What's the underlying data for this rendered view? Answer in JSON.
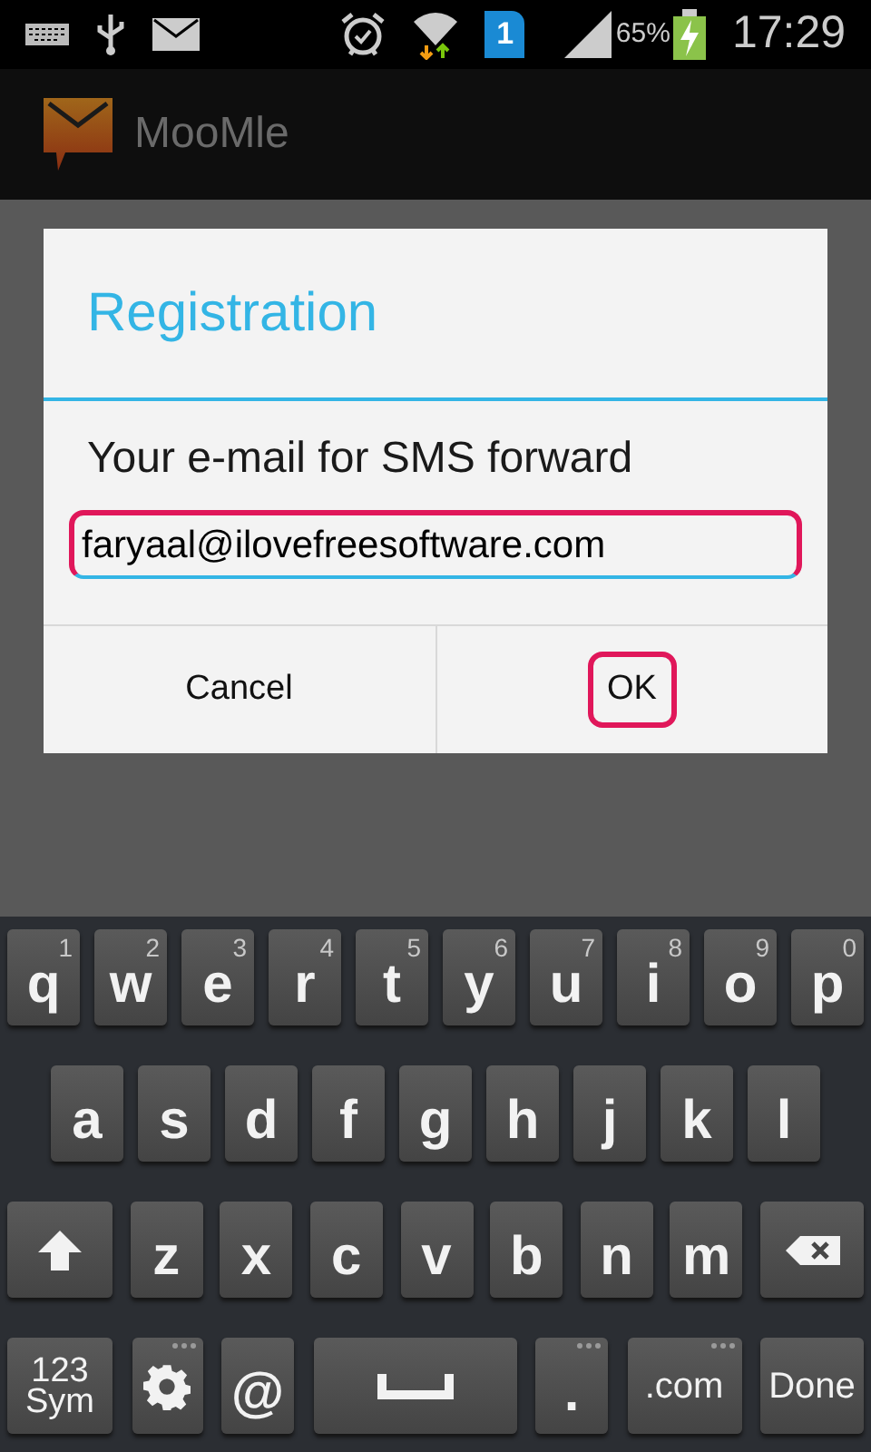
{
  "status_bar": {
    "sim_badge": "1",
    "battery": "65%",
    "time": "17:29"
  },
  "app_bar": {
    "title": "MooMle"
  },
  "dialog": {
    "title": "Registration",
    "label": "Your e-mail for SMS forward",
    "email_field": {
      "value": "faryaal@ilovefreesoftware.com",
      "highlighted": true
    },
    "buttons": [
      {
        "label": "Cancel",
        "highlighted": false
      },
      {
        "label": "OK",
        "highlighted": true
      }
    ]
  },
  "keyboard": {
    "rows": [
      {
        "keys": [
          {
            "kind": "char",
            "label": "q",
            "hint": "1"
          },
          {
            "kind": "char",
            "label": "w",
            "hint": "2"
          },
          {
            "kind": "char",
            "label": "e",
            "hint": "3"
          },
          {
            "kind": "char",
            "label": "r",
            "hint": "4"
          },
          {
            "kind": "char",
            "label": "t",
            "hint": "5"
          },
          {
            "kind": "char",
            "label": "y",
            "hint": "6"
          },
          {
            "kind": "char",
            "label": "u",
            "hint": "7"
          },
          {
            "kind": "char",
            "label": "i",
            "hint": "8"
          },
          {
            "kind": "char",
            "label": "o",
            "hint": "9"
          },
          {
            "kind": "char",
            "label": "p",
            "hint": "0"
          }
        ]
      },
      {
        "keys": [
          {
            "kind": "char",
            "label": "a"
          },
          {
            "kind": "char",
            "label": "s"
          },
          {
            "kind": "char",
            "label": "d"
          },
          {
            "kind": "char",
            "label": "f"
          },
          {
            "kind": "char",
            "label": "g"
          },
          {
            "kind": "char",
            "label": "h"
          },
          {
            "kind": "char",
            "label": "j"
          },
          {
            "kind": "char",
            "label": "k"
          },
          {
            "kind": "char",
            "label": "l"
          }
        ]
      },
      {
        "keys": [
          {
            "kind": "shift"
          },
          {
            "kind": "char",
            "label": "z"
          },
          {
            "kind": "char",
            "label": "x"
          },
          {
            "kind": "char",
            "label": "c"
          },
          {
            "kind": "char",
            "label": "v"
          },
          {
            "kind": "char",
            "label": "b"
          },
          {
            "kind": "char",
            "label": "n"
          },
          {
            "kind": "char",
            "label": "m"
          },
          {
            "kind": "backspace"
          }
        ]
      },
      {
        "keys": [
          {
            "kind": "sym",
            "label": "123",
            "label2": "Sym"
          },
          {
            "kind": "settings",
            "more": true
          },
          {
            "kind": "char",
            "label": "@"
          },
          {
            "kind": "space"
          },
          {
            "kind": "char",
            "label": ".",
            "more": true
          },
          {
            "kind": "wide",
            "label": ".com",
            "more": true
          },
          {
            "kind": "done",
            "label": "Done"
          }
        ]
      }
    ]
  }
}
